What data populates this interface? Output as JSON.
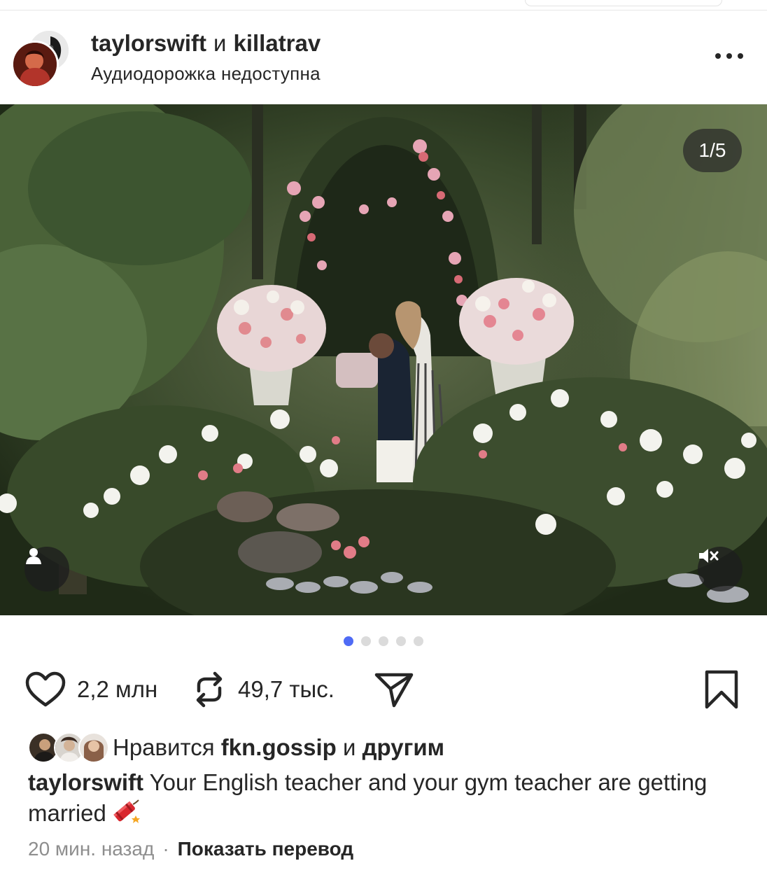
{
  "header": {
    "user1": "taylorswift",
    "conj": "и",
    "user2": "killatrav",
    "subtitle": "Аудиодорожка недоступна",
    "more_icon": "more-horizontal-icon"
  },
  "photo": {
    "counter": "1/5",
    "tag_icon": "user-tag-icon",
    "mute_icon": "sound-off-icon",
    "total_slides": 5,
    "current_slide": 1
  },
  "actions": {
    "likes_count": "2,2 млн",
    "reposts_count": "49,7 тыс.",
    "like_icon": "heart-icon",
    "repost_icon": "repost-icon",
    "share_icon": "send-icon",
    "save_icon": "bookmark-icon"
  },
  "likes": {
    "prefix": "Нравится",
    "user": "fkn.gossip",
    "conj": "и",
    "others": "другим"
  },
  "caption": {
    "user": "taylorswift",
    "text": "Your English teacher and your gym teacher are getting married",
    "emoji_icon": "firecracker-icon"
  },
  "meta": {
    "time": "20 мин. назад",
    "separator": "·",
    "translate": "Показать перевод"
  },
  "colors": {
    "accent_dot": "#4f6bf5",
    "text": "#262626",
    "muted": "#8e8e8e"
  }
}
